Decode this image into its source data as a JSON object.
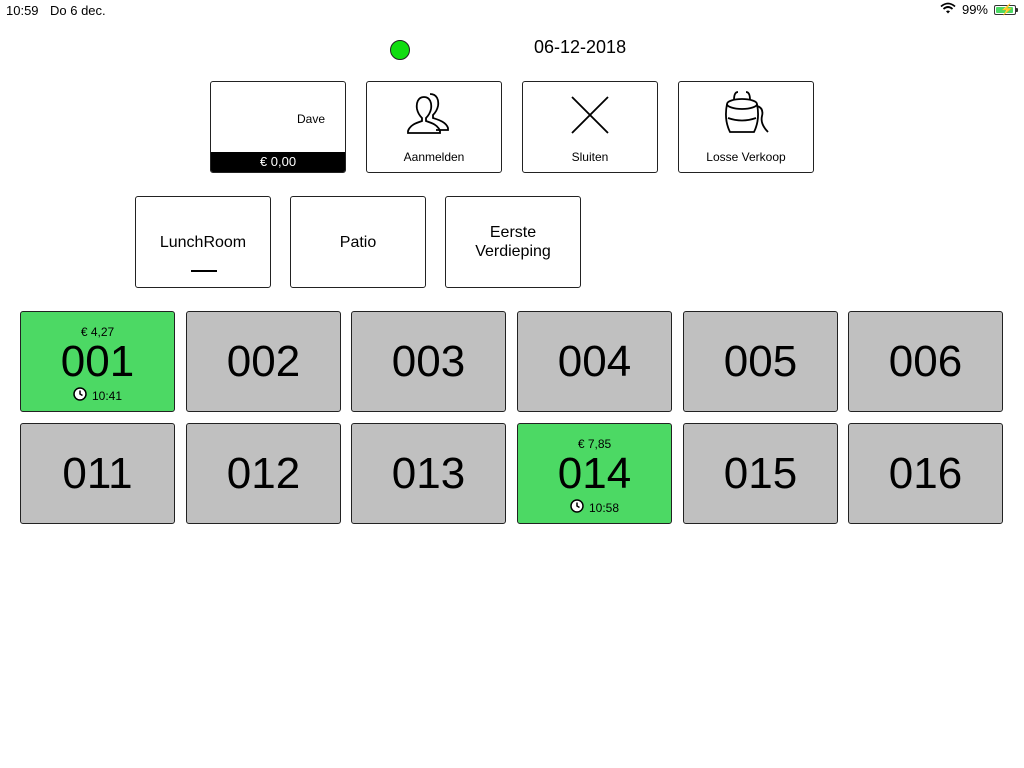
{
  "status_bar": {
    "time": "10:59",
    "date": "Do 6 dec.",
    "battery": "99%",
    "battery_level": 0.99
  },
  "header": {
    "date": "06-12-2018",
    "connection_color": "#11dd11"
  },
  "user_panel": {
    "name": "Dave",
    "balance": "€ 0,00"
  },
  "actions": [
    {
      "label": "Aanmelden",
      "icon": "users-icon"
    },
    {
      "label": "Sluiten",
      "icon": "close-icon"
    },
    {
      "label": "Losse Verkoop",
      "icon": "bag-icon"
    }
  ],
  "rooms": [
    {
      "label": "LunchRoom",
      "selected": true
    },
    {
      "label": "Patio",
      "selected": false
    },
    {
      "label": "Eerste Verdieping",
      "selected": false
    }
  ],
  "tables": [
    {
      "number": "001",
      "status": "occupied",
      "amount": "€ 4,27",
      "time": "10:41"
    },
    {
      "number": "002",
      "status": "free"
    },
    {
      "number": "003",
      "status": "free"
    },
    {
      "number": "004",
      "status": "free"
    },
    {
      "number": "005",
      "status": "free"
    },
    {
      "number": "006",
      "status": "free"
    },
    {
      "number": "011",
      "status": "free"
    },
    {
      "number": "012",
      "status": "free"
    },
    {
      "number": "013",
      "status": "free"
    },
    {
      "number": "014",
      "status": "occupied",
      "amount": "€ 7,85",
      "time": "10:58"
    },
    {
      "number": "015",
      "status": "free"
    },
    {
      "number": "016",
      "status": "free"
    }
  ],
  "colors": {
    "occupied": "#4cd964",
    "free": "#c0c0c0"
  }
}
